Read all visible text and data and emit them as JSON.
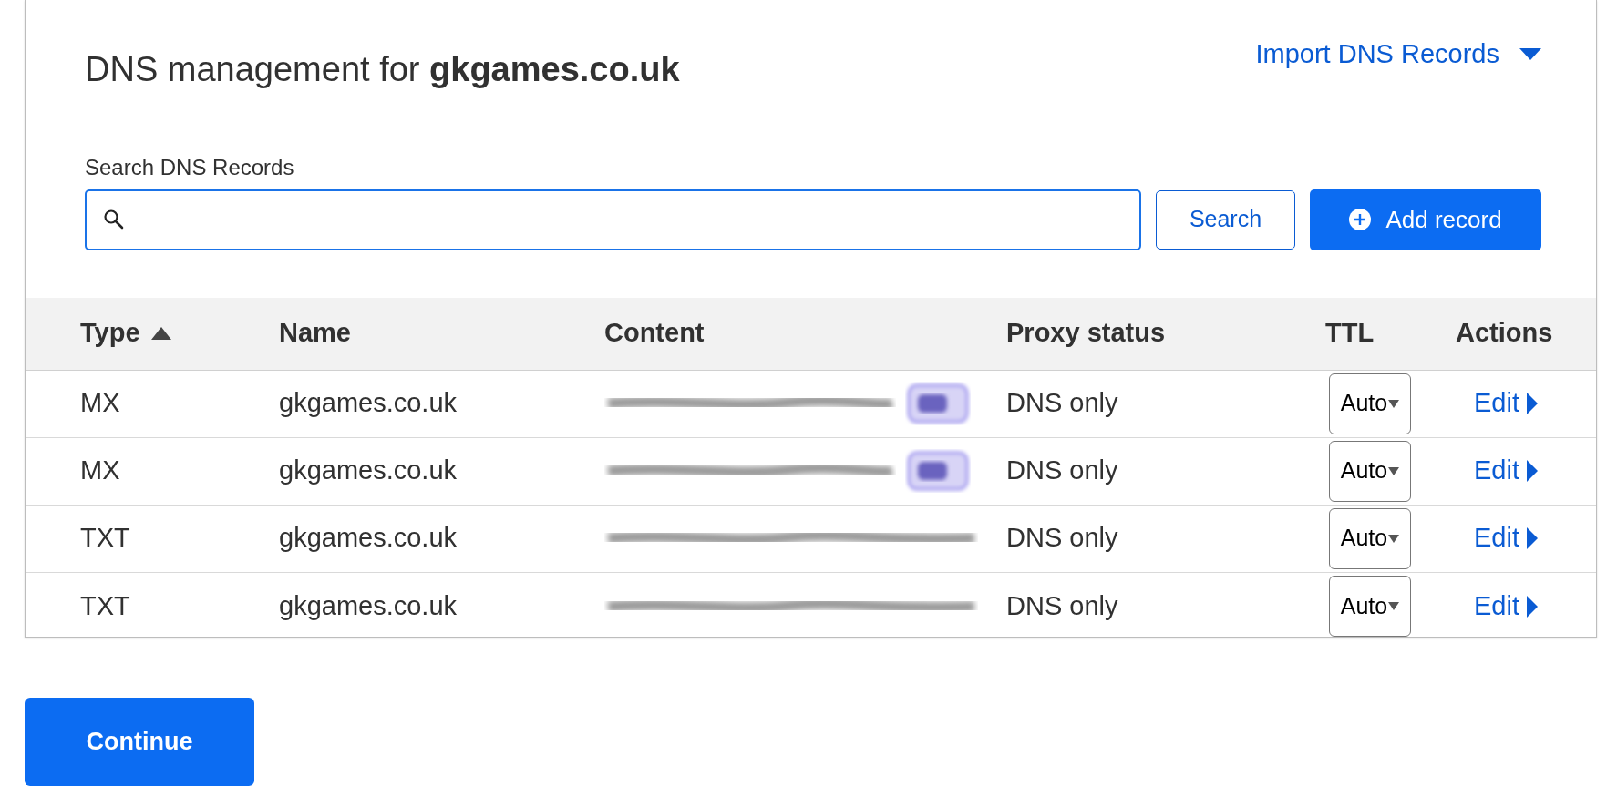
{
  "heading": {
    "prefix": "DNS management for ",
    "domain": "gkgames.co.uk"
  },
  "import_menu": {
    "label": "Import DNS Records"
  },
  "search": {
    "label": "Search DNS Records",
    "button": "Search"
  },
  "add_button": "Add record",
  "table": {
    "columns": [
      {
        "label": "Type",
        "sorted": true
      },
      {
        "label": "Name",
        "sorted": false
      },
      {
        "label": "Content",
        "sorted": false
      },
      {
        "label": "Proxy status",
        "sorted": false
      },
      {
        "label": "TTL",
        "sorted": false
      },
      {
        "label": "Actions",
        "sorted": false
      }
    ],
    "rows": [
      {
        "type": "MX",
        "name": "gkgames.co.uk",
        "content": {
          "kind": "redacted",
          "tag": true
        },
        "proxy": "DNS only",
        "ttl": "Auto",
        "action": "Edit"
      },
      {
        "type": "MX",
        "name": "gkgames.co.uk",
        "content": {
          "kind": "redacted",
          "tag": true
        },
        "proxy": "DNS only",
        "ttl": "Auto",
        "action": "Edit"
      },
      {
        "type": "TXT",
        "name": "gkgames.co.uk",
        "content": {
          "kind": "redacted",
          "tag": false
        },
        "proxy": "DNS only",
        "ttl": "Auto",
        "action": "Edit"
      },
      {
        "type": "TXT",
        "name": "gkgames.co.uk",
        "content": {
          "kind": "redacted",
          "tag": false
        },
        "proxy": "DNS only",
        "ttl": "Auto",
        "action": "Edit"
      }
    ]
  },
  "continue_button": "Continue"
}
